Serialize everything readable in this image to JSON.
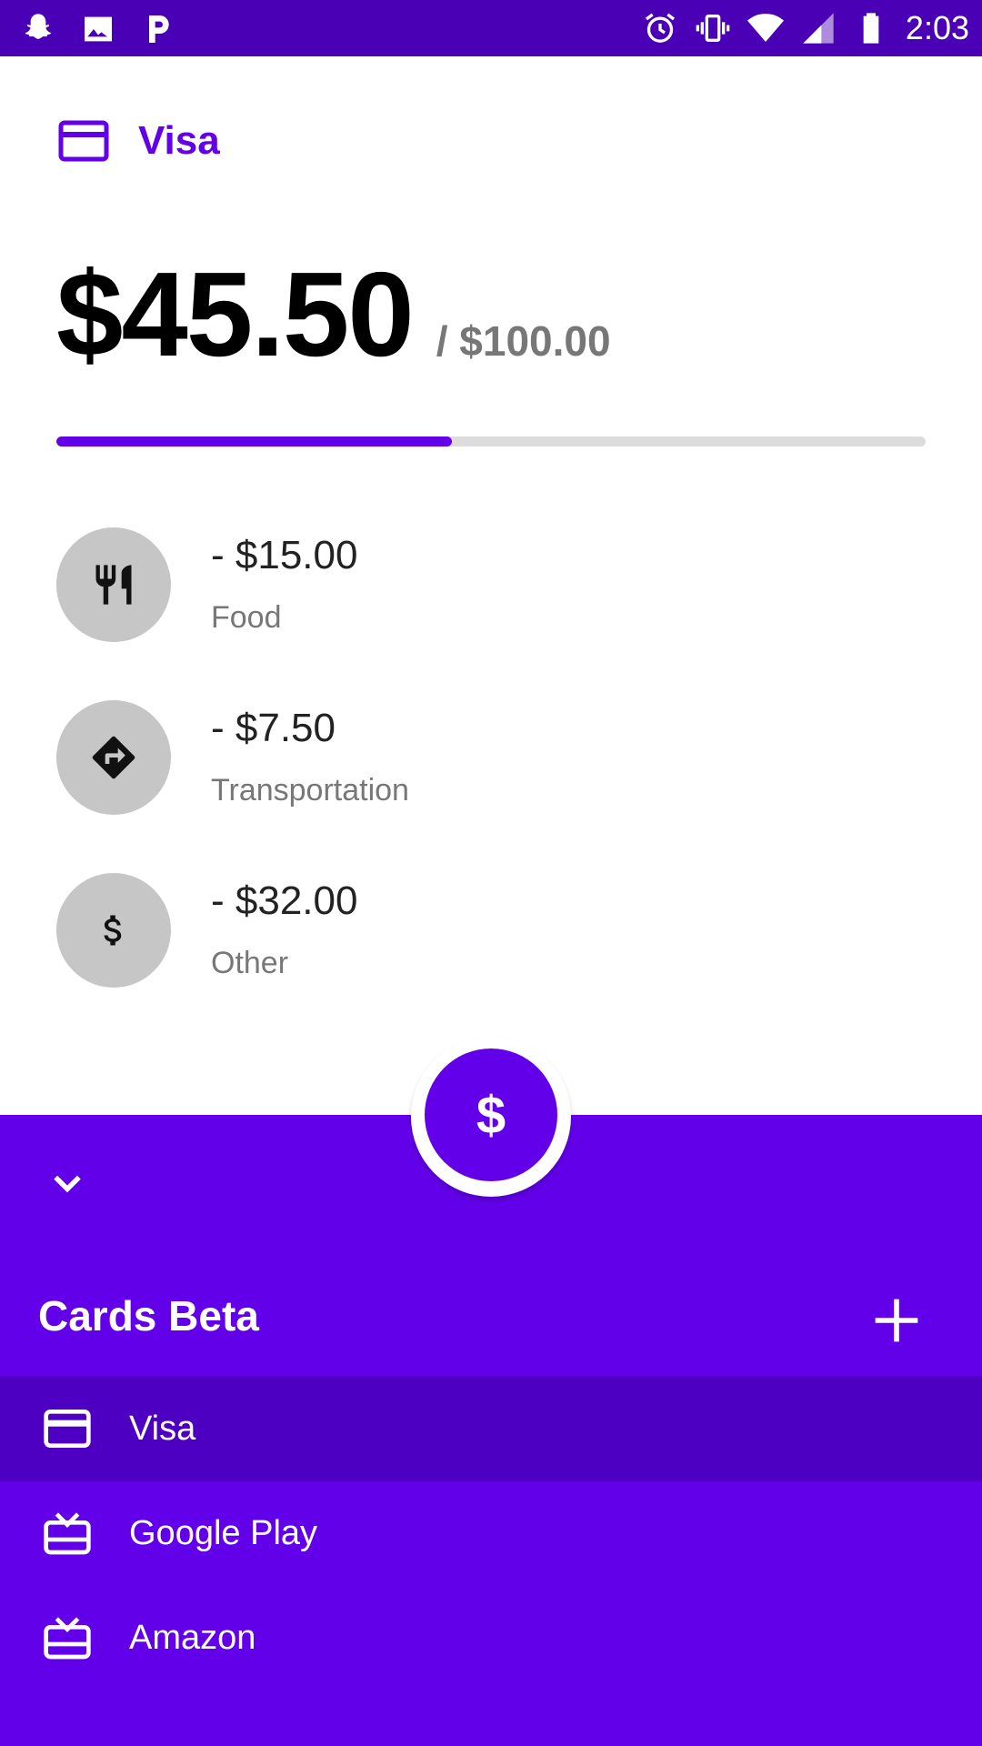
{
  "status_bar": {
    "time": "2:03",
    "left_icons": [
      "snapchat-icon",
      "image-icon",
      "p-app-icon"
    ],
    "right_icons": [
      "alarm-icon",
      "vibrate-icon",
      "wifi-icon",
      "signal-icon",
      "battery-icon"
    ]
  },
  "card": {
    "icon": "credit-card-icon",
    "name": "Visa",
    "spent": "$45.50",
    "total": "/ $100.00",
    "progress_fraction": 0.455
  },
  "expenses": [
    {
      "amount": "- $15.00",
      "category": "Food",
      "icon": "restaurant-icon"
    },
    {
      "amount": "- $7.50",
      "category": "Transportation",
      "icon": "directions-icon"
    },
    {
      "amount": "- $32.00",
      "category": "Other",
      "icon": "dollar-icon"
    }
  ],
  "fab": {
    "label": "$",
    "icon": "dollar-icon"
  },
  "sheet": {
    "collapse_icon": "chevron-down-icon",
    "title": "Cards Beta",
    "add_icon": "plus-icon",
    "cards": [
      {
        "label": "Visa",
        "icon": "credit-card-icon",
        "selected": true
      },
      {
        "label": "Google Play",
        "icon": "gift-card-icon",
        "selected": false
      },
      {
        "label": "Amazon",
        "icon": "gift-card-icon",
        "selected": false
      }
    ]
  },
  "colors": {
    "status_bar": "#4A00B4",
    "accent": "#6200EA",
    "selected_row": "#4E00C2",
    "circle_bg": "#C6C6C6"
  }
}
